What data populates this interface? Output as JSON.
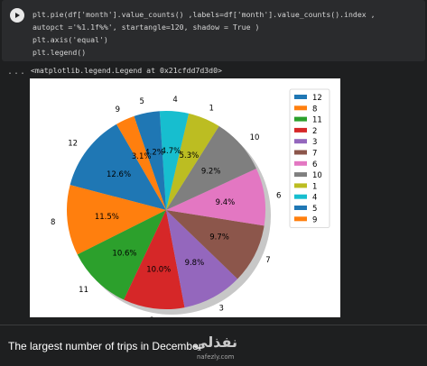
{
  "code_cell": {
    "lines": [
      "plt.pie(df['month'].value_counts() ,labels=df['month'].value_counts().index ,",
      "autopct ='%1.1f%%', startangle=120, shadow = True )",
      "plt.axis('equal')",
      "plt.legend()"
    ]
  },
  "output": {
    "gutter": "...",
    "repr": "<matplotlib.legend.Legend at 0x21cfdd7d3d0>"
  },
  "chart_data": {
    "type": "pie",
    "startangle": 120,
    "shadow": true,
    "categories": [
      "12",
      "8",
      "11",
      "2",
      "3",
      "7",
      "6",
      "10",
      "1",
      "4",
      "5",
      "9"
    ],
    "values": [
      12.6,
      11.5,
      10.6,
      10.0,
      9.8,
      9.7,
      9.4,
      9.2,
      5.3,
      4.7,
      4.2,
      3.1
    ],
    "pct_labels": [
      "12.6%",
      "11.5%",
      "10.6%",
      "10.0%",
      "9.8%",
      "9.7%",
      "9.4%",
      "9.2%",
      "5.3%",
      "4.7%",
      "4.2%",
      "3.1%"
    ],
    "colors": [
      "#1f77b4",
      "#ff7f0e",
      "#2ca02c",
      "#d62728",
      "#9467bd",
      "#8c564b",
      "#e377c2",
      "#7f7f7f",
      "#bcbd22",
      "#17becf",
      "#1f77b4",
      "#ff7f0e"
    ],
    "legend": {
      "placement": "right",
      "entries": [
        "12",
        "8",
        "11",
        "2",
        "3",
        "7",
        "6",
        "10",
        "1",
        "4",
        "5",
        "9"
      ]
    }
  },
  "bottom_text": "The largest number of trips in December",
  "watermark": {
    "arabic": "نفذلي",
    "domain": "nafezly.com"
  }
}
